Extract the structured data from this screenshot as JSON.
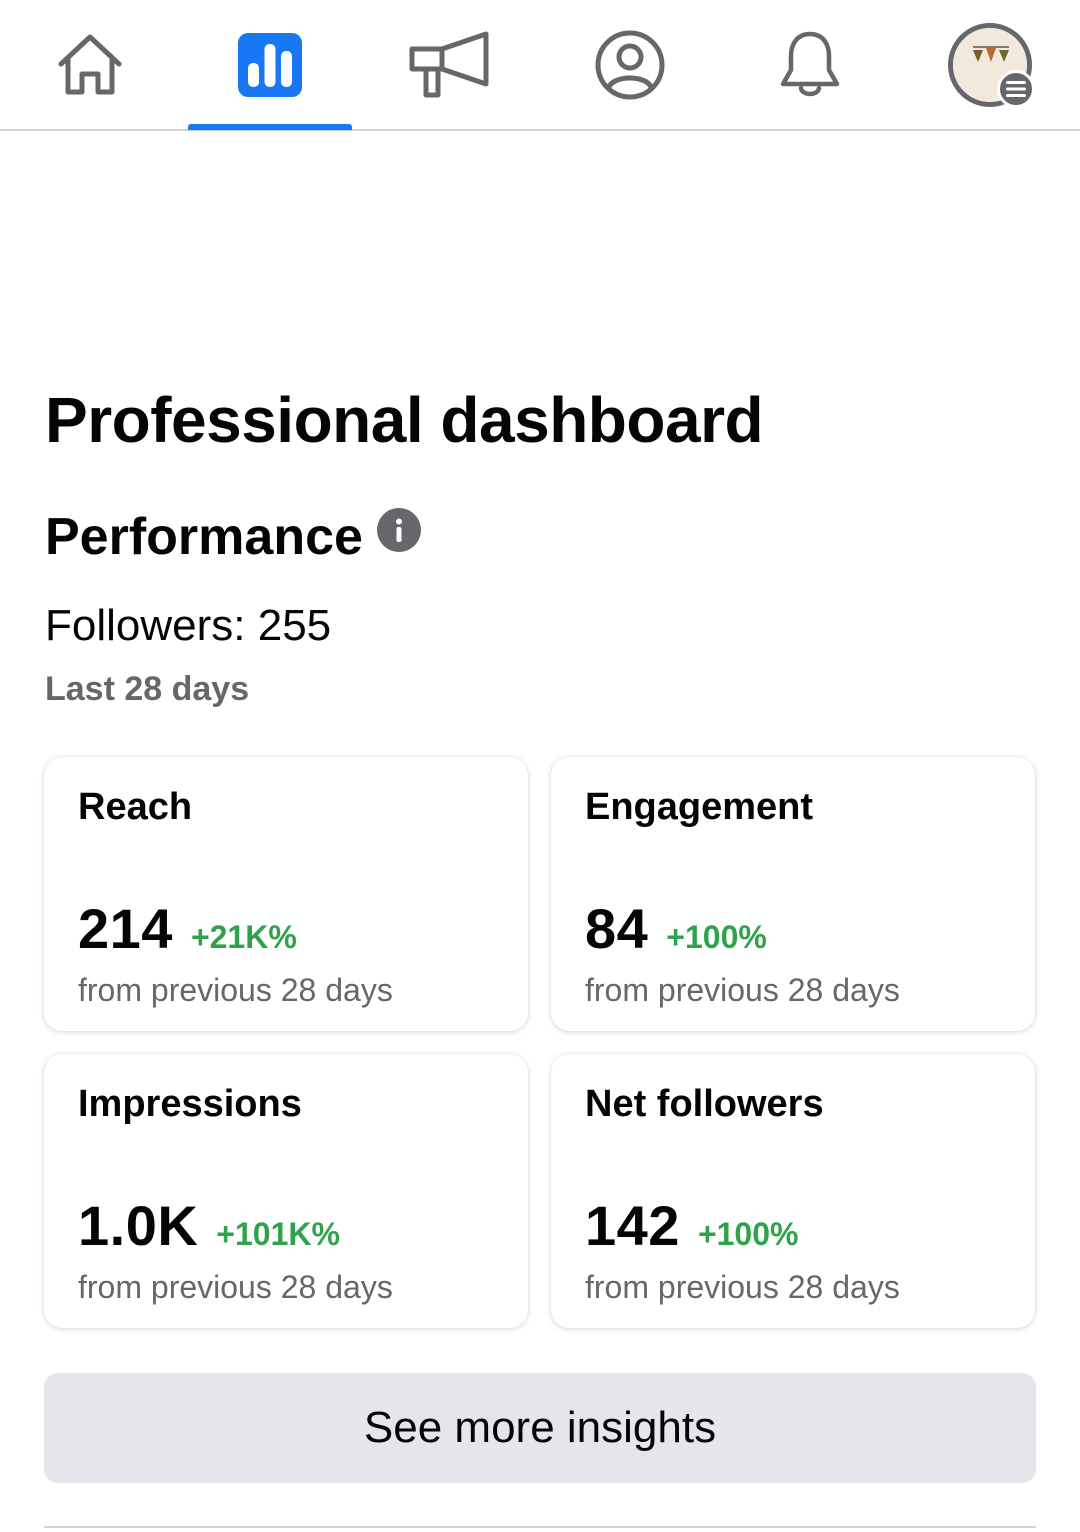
{
  "nav": {
    "items": [
      {
        "icon": "home-icon",
        "active": false
      },
      {
        "icon": "dashboard-bar-chart-icon",
        "active": true
      },
      {
        "icon": "megaphone-icon",
        "active": false
      },
      {
        "icon": "profile-icon",
        "active": false
      },
      {
        "icon": "bell-icon",
        "active": false
      },
      {
        "icon": "avatar-menu-icon",
        "active": false
      }
    ],
    "accent_color": "#1877f2"
  },
  "page_title": "Professional dashboard",
  "performance": {
    "title": "Performance",
    "followers": "Followers: 255",
    "period": "Last 28 days"
  },
  "cards": [
    {
      "title": "Reach",
      "value": "214",
      "change": "+21K%",
      "sub": "from previous 28 days"
    },
    {
      "title": "Engagement",
      "value": "84",
      "change": "+100%",
      "sub": "from previous 28 days"
    },
    {
      "title": "Impressions",
      "value": "1.0K",
      "change": "+101K%",
      "sub": "from previous 28 days"
    },
    {
      "title": "Net followers",
      "value": "142",
      "change": "+100%",
      "sub": "from previous 28 days"
    }
  ],
  "colors": {
    "positive_change": "#31a24c",
    "secondary_text": "#65676b",
    "button_bg": "#e4e6eb"
  },
  "see_more_label": "See more insights"
}
